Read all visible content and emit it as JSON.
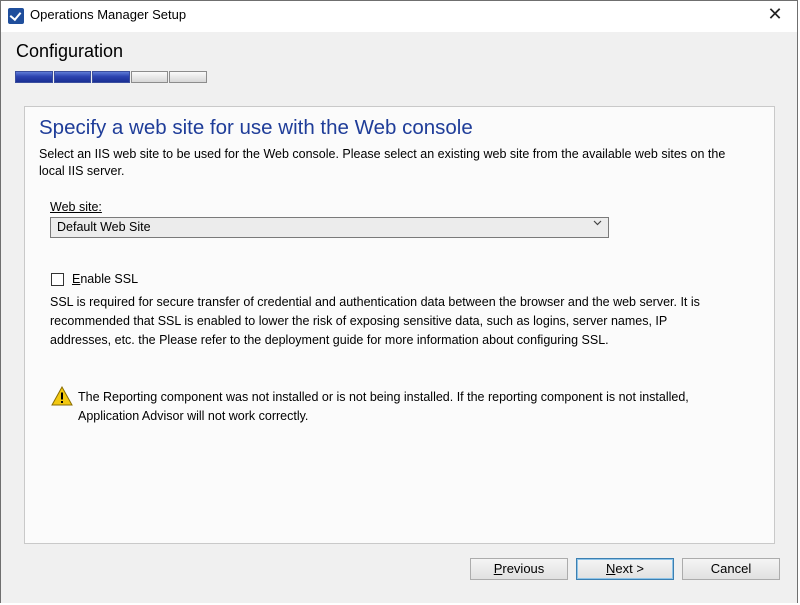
{
  "window": {
    "title": "Operations Manager Setup",
    "close_glyph": "✕"
  },
  "header": {
    "title": "Configuration",
    "progress": {
      "completed_steps": 3,
      "total_steps": 5
    }
  },
  "page": {
    "heading": "Specify a web site for use with the Web console",
    "description": "Select an IIS web site to be used for the Web console. Please select an existing web site from the available web sites on the local IIS server.",
    "website_label_mnemonic": "W",
    "website_label_rest": "eb site:",
    "website_selected": "Default Web Site",
    "ssl_checkbox_mnemonic": "E",
    "ssl_checkbox_rest": "nable SSL",
    "ssl_checked": false,
    "ssl_description": "SSL is required for secure transfer of credential and authentication data between the browser and the web server. It is recommended that SSL is enabled to lower the risk of exposing sensitive data, such as logins, server names, IP addresses, etc. the Please refer to the deployment guide for more information about configuring SSL.",
    "warning_text": "The Reporting component was not installed or is not being installed.  If the reporting component is not installed, Application Advisor will not work correctly."
  },
  "buttons": {
    "previous_mnemonic": "P",
    "previous_rest": "revious",
    "next_mnemonic": "N",
    "next_rest": "ext >",
    "cancel": "Cancel"
  },
  "icons": {
    "app": "setup-app-icon",
    "close": "close-icon",
    "warning": "warning-icon",
    "dropdown": "chevron-down-icon"
  },
  "colors": {
    "heading": "#1f3d99",
    "progress_fill": "#2c44b0",
    "background": "#f0f0f0"
  }
}
